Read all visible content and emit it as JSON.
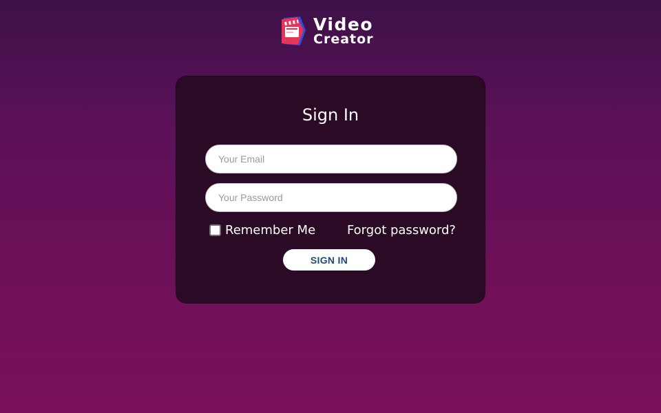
{
  "brand": {
    "name_line1": "Video",
    "name_line2": "Creator",
    "logo_icon": "clapperboard-icon",
    "colors": {
      "blue": "#2b4fd6",
      "red": "#e8345a",
      "pink": "#ff4f9a"
    }
  },
  "signin": {
    "title": "Sign In",
    "email": {
      "placeholder": "Your Email",
      "value": ""
    },
    "password": {
      "placeholder": "Your Password",
      "value": ""
    },
    "remember_label": "Remember Me",
    "remember_checked": false,
    "forgot_label": "Forgot password?",
    "button_label": "SIGN IN"
  },
  "theme": {
    "background_top": "#3d1148",
    "background_bottom": "#7a0f5c",
    "card": "#2a0a24",
    "button_text": "#1f4a7a"
  }
}
